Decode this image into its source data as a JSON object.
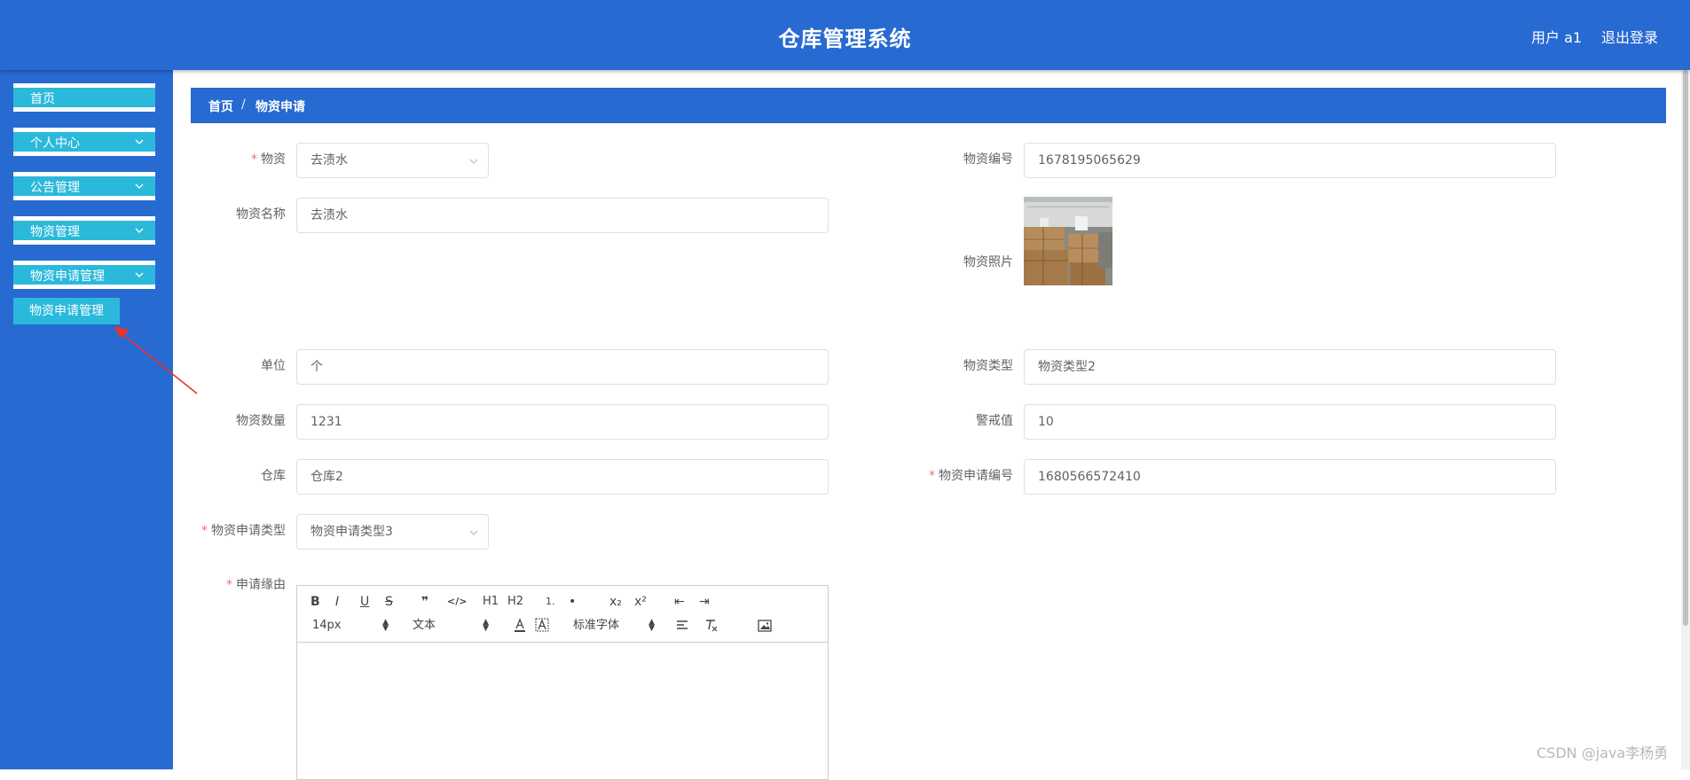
{
  "header": {
    "title": "仓库管理系统",
    "user": "用户 a1",
    "logout": "退出登录"
  },
  "sidebar": {
    "items": [
      {
        "label": "首页",
        "expandable": false
      },
      {
        "label": "个人中心",
        "expandable": true
      },
      {
        "label": "公告管理",
        "expandable": true
      },
      {
        "label": "物资管理",
        "expandable": true
      },
      {
        "label": "物资申请管理",
        "expandable": true
      }
    ],
    "submenu": {
      "label": "物资申请管理"
    }
  },
  "breadcrumb": {
    "home": "首页",
    "separator": "/",
    "current": "物资申请"
  },
  "form": {
    "material": {
      "label": "物资",
      "value": "去渍水",
      "required": true
    },
    "material_code": {
      "label": "物资编号",
      "value": "1678195065629"
    },
    "material_name": {
      "label": "物资名称",
      "value": "去渍水"
    },
    "material_photo": {
      "label": "物资照片"
    },
    "unit": {
      "label": "单位",
      "value": "个"
    },
    "material_type": {
      "label": "物资类型",
      "value": "物资类型2"
    },
    "quantity": {
      "label": "物资数量",
      "value": "1231"
    },
    "alert_value": {
      "label": "警戒值",
      "value": "10"
    },
    "warehouse": {
      "label": "仓库",
      "value": "仓库2"
    },
    "apply_code": {
      "label": "物资申请编号",
      "value": "1680566572410",
      "required": true
    },
    "apply_type": {
      "label": "物资申请类型",
      "value": "物资申请类型3",
      "required": true
    },
    "reason": {
      "label": "申请缘由",
      "required": true
    }
  },
  "editor": {
    "font_size": "14px",
    "format": "文本",
    "font_family": "标准字体",
    "tools": [
      "B",
      "I",
      "U",
      "S",
      "❞",
      "</>",
      "H1",
      "H2",
      "1.",
      "•",
      "x₂",
      "x²",
      "⇤",
      "⇥"
    ]
  },
  "watermark": "CSDN @java李杨勇",
  "colors": {
    "primary": "#276ad2",
    "menu": "#2bb9db",
    "required": "#f56c6c"
  }
}
